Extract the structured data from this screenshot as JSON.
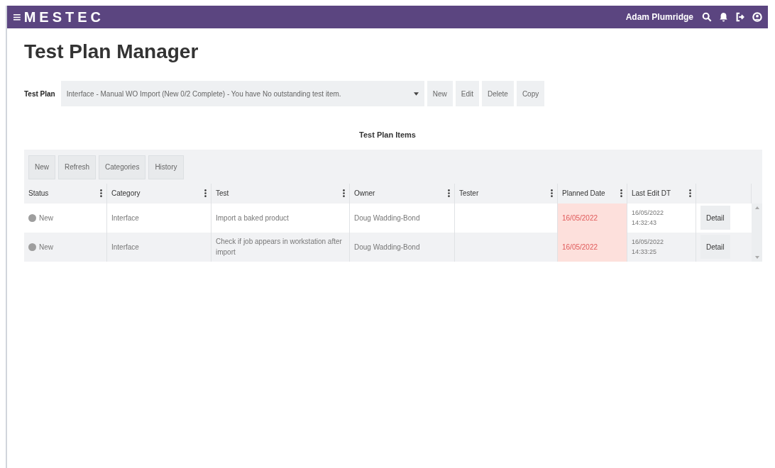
{
  "header": {
    "menu_glyph": "≡",
    "logo": "MESTEC",
    "user": "Adam Plumridge"
  },
  "title": "Test Plan Manager",
  "test_plan": {
    "label": "Test Plan",
    "value": "Interface - Manual WO Import (New 0/2 Complete) - You have No outstanding test item.",
    "buttons": [
      "New",
      "Edit",
      "Delete",
      "Copy"
    ]
  },
  "items": {
    "title": "Test Plan Items",
    "toolbar": [
      "New",
      "Refresh",
      "Categories",
      "History"
    ],
    "columns": [
      "Status",
      "Category",
      "Test",
      "Owner",
      "Tester",
      "Planned Date",
      "Last Edit DT"
    ],
    "rows": [
      {
        "status": "New",
        "color": "#9e9e9e",
        "category": "Interface",
        "test": "Import a baked product",
        "owner": "Doug Wadding-Bond",
        "planned": "16/05/2022",
        "overdue": true,
        "last_edit": [
          "16/05/2022",
          "14:32:43"
        ],
        "action": "Detail"
      },
      {
        "status": "New",
        "color": "#9e9e9e",
        "category": "Interface",
        "test": "Check if job appears in workstation after import",
        "owner": "Doug Wadding-Bond",
        "planned": "16/05/2022",
        "overdue": true,
        "last_edit": [
          "16/05/2022",
          "14:33:25"
        ],
        "action": "Detail"
      }
    ]
  }
}
